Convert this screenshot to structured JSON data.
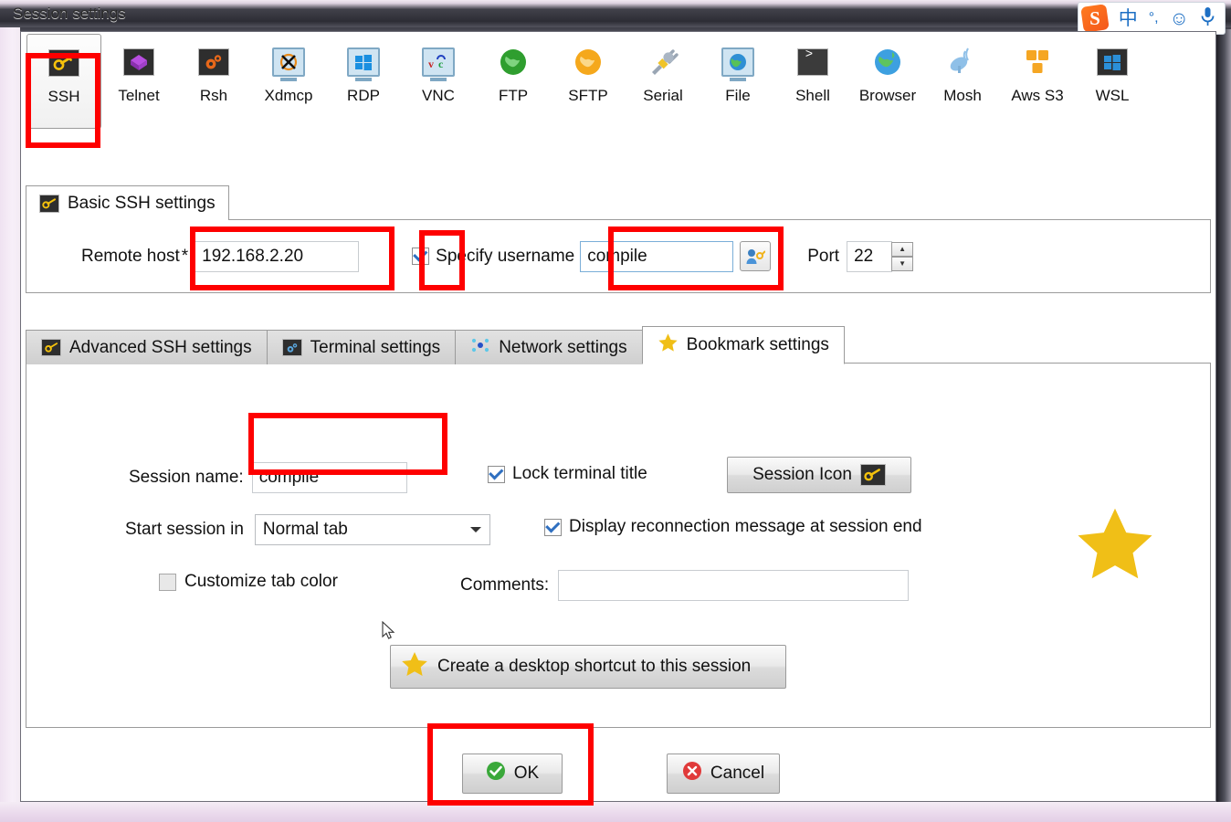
{
  "window": {
    "title": "Session settings",
    "frame_color": "#efe6f2",
    "accent_red": "#fe0000",
    "star_gold": "#f0bf17"
  },
  "ime": {
    "logo_letter": "S",
    "items": [
      {
        "name": "chinese-mode-icon",
        "glyph": "中"
      },
      {
        "name": "punctuation-icon",
        "glyph": "°,"
      },
      {
        "name": "emoji-icon",
        "glyph": "☺"
      },
      {
        "name": "microphone-icon",
        "glyph": "🎙"
      }
    ]
  },
  "session_types": [
    {
      "label": "SSH",
      "icon": "ssh-key-icon",
      "selected": true
    },
    {
      "label": "Telnet",
      "icon": "telnet-cube-icon",
      "selected": false
    },
    {
      "label": "Rsh",
      "icon": "rsh-gears-icon",
      "selected": false
    },
    {
      "label": "Xdmcp",
      "icon": "xdmcp-monitor-icon",
      "selected": false
    },
    {
      "label": "RDP",
      "icon": "rdp-windows-icon",
      "selected": false
    },
    {
      "label": "VNC",
      "icon": "vnc-monitor-icon",
      "selected": false
    },
    {
      "label": "FTP",
      "icon": "ftp-globe-icon",
      "selected": false
    },
    {
      "label": "SFTP",
      "icon": "sftp-globe-icon",
      "selected": false
    },
    {
      "label": "Serial",
      "icon": "serial-plug-icon",
      "selected": false
    },
    {
      "label": "File",
      "icon": "file-monitor-icon",
      "selected": false
    },
    {
      "label": "Shell",
      "icon": "shell-prompt-icon",
      "selected": false
    },
    {
      "label": "Browser",
      "icon": "browser-globe-icon",
      "selected": false
    },
    {
      "label": "Mosh",
      "icon": "mosh-antenna-icon",
      "selected": false
    },
    {
      "label": "Aws S3",
      "icon": "aws-s3-cubes-icon",
      "selected": false
    },
    {
      "label": "WSL",
      "icon": "wsl-windows-icon",
      "selected": false
    }
  ],
  "basic": {
    "group_title": "Basic SSH settings",
    "remote_host_label": "Remote host",
    "required_marker": "*",
    "remote_host_value": "192.168.2.20",
    "specify_username_label": "Specify username",
    "specify_username_checked": true,
    "username_value": "compile",
    "port_label": "Port",
    "port_value": "22",
    "spin_up": "▲",
    "spin_down": "▼"
  },
  "tabs": [
    {
      "label": "Advanced SSH settings",
      "icon": "key-icon",
      "active": false
    },
    {
      "label": "Terminal settings",
      "icon": "gear-icon",
      "active": false
    },
    {
      "label": "Network settings",
      "icon": "network-icon",
      "active": false
    },
    {
      "label": "Bookmark settings",
      "icon": "star-icon",
      "active": true
    }
  ],
  "bookmark": {
    "session_name_label": "Session name:",
    "session_name_value": "compile",
    "lock_terminal_title_label": "Lock terminal title",
    "lock_terminal_title_checked": true,
    "session_icon_button": "Session Icon",
    "start_session_label": "Start session in",
    "start_session_value": "Normal tab",
    "start_session_options": [
      "Normal tab"
    ],
    "display_reconnection_label": "Display reconnection message at session end",
    "display_reconnection_checked": true,
    "customize_tab_color_label": "Customize tab color",
    "customize_tab_color_checked": false,
    "comments_label": "Comments:",
    "comments_value": "",
    "comments_placeholder": "",
    "shortcut_button": "Create a desktop shortcut to this session"
  },
  "footer": {
    "ok_label": "OK",
    "cancel_label": "Cancel"
  }
}
